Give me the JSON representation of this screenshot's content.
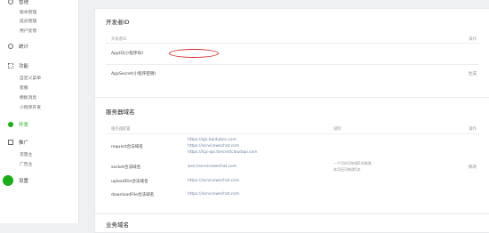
{
  "sidebar": {
    "groups": [
      {
        "label": "管理",
        "icon": "settings-icon"
      },
      {
        "label": "统计",
        "icon": "chart-icon"
      },
      {
        "label": "功能",
        "icon": "grid-icon"
      },
      {
        "label": "开发",
        "icon": "code-icon"
      },
      {
        "label": "推广",
        "icon": "promote-icon"
      },
      {
        "label": "设置",
        "icon": "gear-icon"
      }
    ],
    "sub_manage": [
      "版本管理",
      "成员管理",
      "用户反馈"
    ],
    "sub_function": [
      "自定义菜单",
      "客服",
      "模板消息",
      "小程序开发"
    ],
    "sub_promote": [
      "流量主",
      "广告主"
    ]
  },
  "dev_id_card": {
    "title": "开发者ID",
    "col_id": "开发者ID",
    "col_action": "操作",
    "rows": [
      {
        "label": "AppID(小程序ID)",
        "value": "",
        "action": ""
      },
      {
        "label": "AppSecret(小程序密钥)",
        "value": "",
        "action": "生成"
      }
    ]
  },
  "server_card": {
    "title": "服务器域名",
    "col_name": "服务器配置",
    "col_desc": "说明",
    "col_action": "操作",
    "rows": [
      {
        "label": "request合法域名",
        "urls": [
          "https://api.baidubce.com",
          "https://servicewechat.com",
          "https://tcp-api.tencentcloudapi.com"
        ],
        "desc": "",
        "action": ""
      },
      {
        "label": "socket合法域名",
        "urls": [
          "wss://servicewechat.com"
        ],
        "desc": "一个月内可申请5次修改\n本月还可修改5次",
        "action": "修改"
      },
      {
        "label": "uploadFile合法域名",
        "urls": [
          "https://servicewechat.com"
        ],
        "desc": "",
        "action": ""
      },
      {
        "label": "downloadFile合法域名",
        "urls": [
          "https://servicewechat.com"
        ],
        "desc": "",
        "action": ""
      }
    ]
  },
  "third_card": {
    "title": "业务域名"
  },
  "colors": {
    "accent": "#1aad19",
    "annotation": "#d02424"
  }
}
